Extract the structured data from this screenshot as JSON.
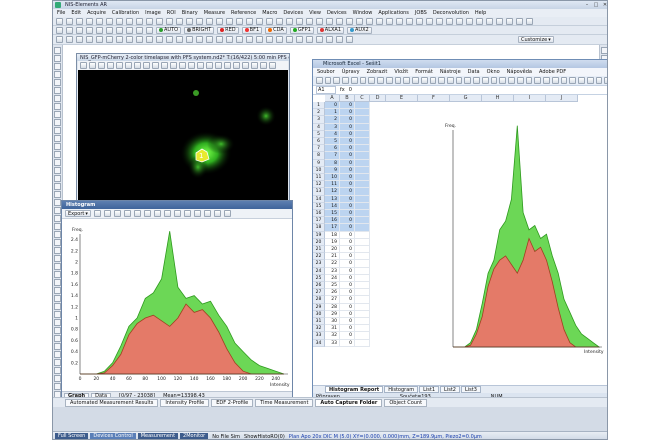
{
  "window": {
    "title": "NIS-Elements AR"
  },
  "menu": [
    "File",
    "Edit",
    "Acquire",
    "Calibration",
    "Image",
    "ROI",
    "Binary",
    "Measure",
    "Reference",
    "Macro",
    "Devices",
    "View",
    "Devices",
    "Window",
    "Applications",
    "JOBS",
    "Deconvolution",
    "Help"
  ],
  "toolbar": {
    "row2_labels": [
      "AUTO",
      "BRIGHT",
      "RED",
      "BF1",
      "CDA",
      "GFP1",
      "ALXA1",
      "AUX2"
    ],
    "row3_right": "Customize"
  },
  "image_window": {
    "title": "NIS_GFP-mCherry 2-color timelapse with PFS system.nd2*  T:(16/422)  5:00 min  PFS overall: 0.0(0)",
    "roi_label": "1"
  },
  "histogram": {
    "title": "Histogram",
    "export_label": "Export",
    "tabs": [
      "Graph",
      "Data"
    ],
    "status": [
      "[0/97 - 23038]",
      "Mean=13398.43"
    ],
    "y_label": "Freq.",
    "x_label": "Intensity",
    "yticks": [
      "2.4",
      "2.2",
      "2",
      "1.8",
      "1.6",
      "1.4",
      "1.2",
      "1",
      "0.8",
      "0.6",
      "0.4",
      "0.2"
    ],
    "xticks": [
      "0",
      "20",
      "40",
      "60",
      "80",
      "100",
      "120",
      "140",
      "160",
      "180",
      "200",
      "220",
      "240"
    ]
  },
  "excel": {
    "title": "Microsoft Excel - Sešit1",
    "menu": [
      "Soubor",
      "Úpravy",
      "Zobrazit",
      "Vložit",
      "Formát",
      "Nástroje",
      "Data",
      "Okno",
      "Nápověda",
      "Adobe PDF"
    ],
    "namebox": "A1",
    "formula": "0",
    "columns": [
      "A",
      "B",
      "C",
      "D",
      "E",
      "F",
      "G",
      "H",
      "I",
      "J"
    ],
    "rows": [
      {
        "n": "1",
        "a": "0",
        "b": "0"
      },
      {
        "n": "2",
        "a": "1",
        "b": "0"
      },
      {
        "n": "3",
        "a": "2",
        "b": "0"
      },
      {
        "n": "4",
        "a": "3",
        "b": "0"
      },
      {
        "n": "5",
        "a": "4",
        "b": "0"
      },
      {
        "n": "6",
        "a": "5",
        "b": "0"
      },
      {
        "n": "7",
        "a": "6",
        "b": "0"
      },
      {
        "n": "8",
        "a": "7",
        "b": "0"
      },
      {
        "n": "9",
        "a": "8",
        "b": "0"
      },
      {
        "n": "10",
        "a": "9",
        "b": "0"
      },
      {
        "n": "11",
        "a": "10",
        "b": "0"
      },
      {
        "n": "12",
        "a": "11",
        "b": "0"
      },
      {
        "n": "13",
        "a": "12",
        "b": "0"
      },
      {
        "n": "14",
        "a": "13",
        "b": "0"
      },
      {
        "n": "15",
        "a": "14",
        "b": "0"
      },
      {
        "n": "16",
        "a": "15",
        "b": "0"
      },
      {
        "n": "17",
        "a": "16",
        "b": "0"
      },
      {
        "n": "18",
        "a": "17",
        "b": "0"
      },
      {
        "n": "19",
        "a": "18",
        "b": "0"
      },
      {
        "n": "20",
        "a": "19",
        "b": "0"
      },
      {
        "n": "21",
        "a": "20",
        "b": "0"
      },
      {
        "n": "22",
        "a": "21",
        "b": "0"
      },
      {
        "n": "23",
        "a": "22",
        "b": "0"
      },
      {
        "n": "24",
        "a": "23",
        "b": "0"
      },
      {
        "n": "25",
        "a": "24",
        "b": "0"
      },
      {
        "n": "26",
        "a": "25",
        "b": "0"
      },
      {
        "n": "27",
        "a": "26",
        "b": "0"
      },
      {
        "n": "28",
        "a": "27",
        "b": "0"
      },
      {
        "n": "29",
        "a": "28",
        "b": "0"
      },
      {
        "n": "30",
        "a": "29",
        "b": "0"
      },
      {
        "n": "31",
        "a": "30",
        "b": "0"
      },
      {
        "n": "32",
        "a": "31",
        "b": "0"
      },
      {
        "n": "33",
        "a": "32",
        "b": "0"
      },
      {
        "n": "34",
        "a": "33",
        "b": "0"
      }
    ],
    "sheet_tabs": [
      "Histogram Report",
      "Histogram",
      "List1",
      "List2",
      "List3"
    ],
    "status_left": "Připraven",
    "status_sum": "Součet=193",
    "status_right": "NUM",
    "chart_y_label": "Freq.",
    "chart_x_label": "Intensity"
  },
  "bottom_tabs": [
    "Automated Measurement Results",
    "Intensity Profile",
    "EDF 2-Profile",
    "Time Measurement",
    "Auto Capture Folder",
    "Object Count"
  ],
  "status_bar": {
    "buttons": [
      "Full Screen",
      "Devices Control",
      "Measurement",
      "2Monitor"
    ],
    "file": "No File Sim",
    "show": "ShowHistoRO(0)",
    "coords": "Plan Apo 20x DIC M (5.0)  XY=(0.000, 0.000)mm, Z=189.9µm, Piezo2=0.0µm"
  },
  "chart_data": [
    {
      "type": "area",
      "title": "Histogram",
      "xlabel": "Intensity",
      "ylabel": "Freq.",
      "ylim": [
        0,
        2.5
      ],
      "xlim": [
        0,
        255
      ],
      "x": [
        0,
        10,
        20,
        30,
        40,
        50,
        60,
        70,
        80,
        90,
        100,
        110,
        120,
        130,
        140,
        150,
        160,
        170,
        180,
        190,
        200,
        210,
        220,
        230,
        240,
        250
      ],
      "series": [
        {
          "color": "#52d038",
          "values": [
            0,
            0,
            0,
            0.05,
            0.2,
            0.5,
            0.85,
            1.0,
            1.35,
            1.45,
            1.7,
            2.55,
            1.55,
            1.35,
            1.4,
            1.25,
            1.3,
            1.05,
            0.85,
            0.55,
            0.4,
            0.25,
            0.15,
            0.1,
            0.05,
            0
          ]
        },
        {
          "color": "#f2706a",
          "values": [
            0,
            0,
            0,
            0.02,
            0.15,
            0.35,
            0.7,
            0.9,
            1.0,
            1.05,
            0.95,
            0.85,
            1.0,
            1.25,
            1.1,
            1.15,
            1.0,
            0.75,
            0.45,
            0.2,
            0.05,
            0,
            0,
            0,
            0,
            0
          ]
        }
      ]
    },
    {
      "type": "area",
      "xlabel": "Intensity",
      "ylabel": "Freq.",
      "ylim": [
        0,
        2.5
      ],
      "xlim": [
        0,
        255
      ],
      "x": [
        0,
        10,
        20,
        30,
        40,
        50,
        60,
        70,
        80,
        90,
        100,
        110,
        120,
        130,
        140,
        150,
        160,
        170,
        180,
        190,
        200,
        210,
        220,
        230,
        240,
        250
      ],
      "series": [
        {
          "color": "#52d038",
          "values": [
            0,
            0,
            0,
            0.05,
            0.2,
            0.5,
            0.85,
            1.0,
            1.35,
            1.45,
            1.7,
            2.55,
            1.55,
            1.35,
            1.4,
            1.25,
            1.3,
            1.05,
            0.85,
            0.55,
            0.4,
            0.25,
            0.15,
            0.1,
            0.05,
            0
          ]
        },
        {
          "color": "#f2706a",
          "values": [
            0,
            0,
            0,
            0.02,
            0.15,
            0.35,
            0.7,
            0.9,
            1.0,
            1.05,
            0.95,
            0.85,
            1.0,
            1.25,
            1.1,
            1.15,
            1.0,
            0.75,
            0.45,
            0.2,
            0.05,
            0,
            0,
            0,
            0,
            0
          ]
        }
      ]
    }
  ]
}
